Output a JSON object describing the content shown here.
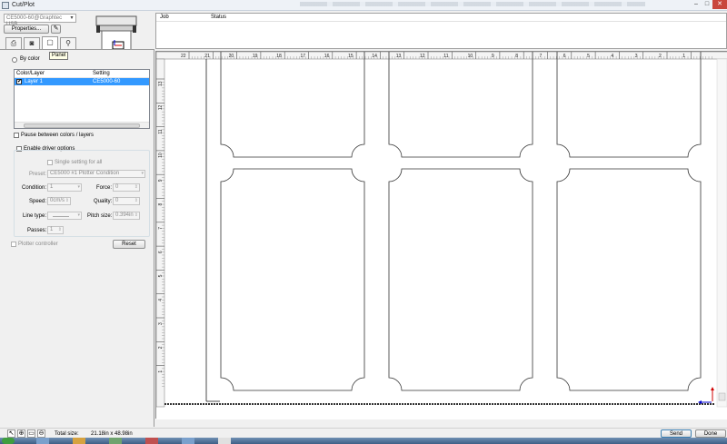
{
  "window": {
    "title": "Cut/Plot",
    "min": "–",
    "max": "□",
    "close": "✕"
  },
  "device": {
    "selected": "CE5000-60@Graphtec USB",
    "properties_label": "Properties..."
  },
  "job_table": {
    "columns": [
      "Job",
      "Status"
    ]
  },
  "tabs": [
    {
      "name": "printer-icon",
      "glyph": "🖶"
    },
    {
      "name": "color-icon",
      "glyph": "▣"
    },
    {
      "name": "panel-icon",
      "glyph": "▢"
    },
    {
      "name": "knife-icon",
      "glyph": "⚲"
    }
  ],
  "tooltip": "Panel",
  "left": {
    "by_color_label": "By color",
    "list_headers": {
      "color_layer": "Color/Layer",
      "setting": "Setting"
    },
    "layers": [
      {
        "name": "Layer 1",
        "setting": "CE5000-60",
        "checked": true
      }
    ],
    "pause_label": "Pause between colors / layers",
    "enable_driver_label": "Enable driver options",
    "single_setting_label": "Single setting for all",
    "preset_label": "Preset:",
    "preset_value": "CE5000 #1 Plotter Condition",
    "condition_label": "Condition:",
    "condition_value": "1",
    "force_label": "Force:",
    "force_value": "0",
    "speed_label": "Speed:",
    "speed_value": "0cm/s",
    "quality_label": "Quality:",
    "quality_value": "0",
    "linetype_label": "Line type:",
    "pitch_label": "Pitch size:",
    "pitch_value": "0.394in",
    "passes_label": "Passes:",
    "passes_value": "1",
    "plotter_controller_label": "Plotter controller",
    "reset_label": "Reset"
  },
  "ruler": {
    "top_labels": [
      "22",
      "21",
      "20",
      "19",
      "18",
      "17",
      "16",
      "15",
      "14",
      "13",
      "12",
      "11",
      "10",
      "9",
      "8",
      "7",
      "6",
      "5",
      "4",
      "3",
      "2",
      "1"
    ],
    "left_labels": [
      "13",
      "12",
      "11",
      "10",
      "9",
      "8",
      "7",
      "6",
      "5",
      "4",
      "3",
      "2",
      "1"
    ]
  },
  "status": {
    "total_size_label": "Total size:",
    "total_size_value": "21.18in x 48.98in",
    "send_label": "Send",
    "done_label": "Done"
  },
  "colors": {
    "selection": "#3399ff",
    "axis_x": "#d00000",
    "axis_y": "#0000d0"
  }
}
